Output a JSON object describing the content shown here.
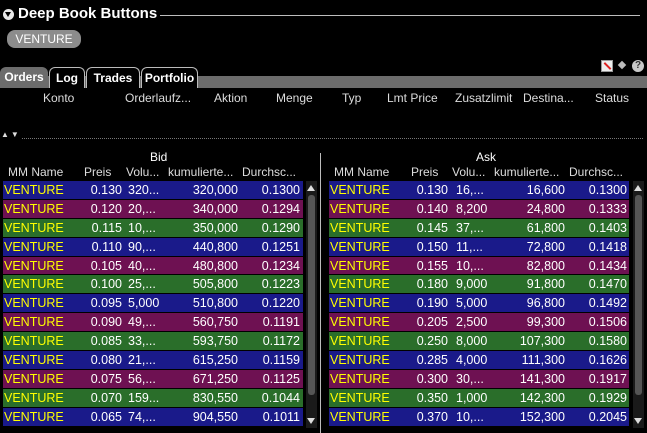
{
  "window": {
    "title": "Deep Book Buttons"
  },
  "symbol_chip": "VENTURE",
  "tabs": [
    "Orders",
    "Log",
    "Trades",
    "Portfolio"
  ],
  "toolbar_icons": [
    "no-edit-icon",
    "wrench-icon",
    "help-icon"
  ],
  "help_glyph": "?",
  "orders_columns": [
    "Konto",
    "Orderlaufz...",
    "Aktion",
    "Menge",
    "Typ",
    "Lmt Price",
    "Zusatzlimit",
    "Destina...",
    "Status"
  ],
  "bid": {
    "title": "Bid",
    "columns": [
      "MM Name",
      "Preis",
      "Volu...",
      "kumulierte...",
      "Durchsc..."
    ],
    "rows": [
      {
        "mm": "VENTURE",
        "price": "0.130",
        "vol": "320...",
        "cum": "320,000",
        "avg": "0.1300",
        "color": "#1a1a8a"
      },
      {
        "mm": "VENTURE",
        "price": "0.120",
        "vol": "20,...",
        "cum": "340,000",
        "avg": "0.1294",
        "color": "#6e1152"
      },
      {
        "mm": "VENTURE",
        "price": "0.115",
        "vol": "10,...",
        "cum": "350,000",
        "avg": "0.1290",
        "color": "#2a6e2a"
      },
      {
        "mm": "VENTURE",
        "price": "0.110",
        "vol": "90,...",
        "cum": "440,800",
        "avg": "0.1251",
        "color": "#1a1a8a"
      },
      {
        "mm": "VENTURE",
        "price": "0.105",
        "vol": "40,...",
        "cum": "480,800",
        "avg": "0.1234",
        "color": "#6e1152"
      },
      {
        "mm": "VENTURE",
        "price": "0.100",
        "vol": "25,...",
        "cum": "505,800",
        "avg": "0.1223",
        "color": "#2a6e2a"
      },
      {
        "mm": "VENTURE",
        "price": "0.095",
        "vol": "5,000",
        "cum": "510,800",
        "avg": "0.1220",
        "color": "#1a1a8a"
      },
      {
        "mm": "VENTURE",
        "price": "0.090",
        "vol": "49,...",
        "cum": "560,750",
        "avg": "0.1191",
        "color": "#6e1152"
      },
      {
        "mm": "VENTURE",
        "price": "0.085",
        "vol": "33,...",
        "cum": "593,750",
        "avg": "0.1172",
        "color": "#2a6e2a"
      },
      {
        "mm": "VENTURE",
        "price": "0.080",
        "vol": "21,...",
        "cum": "615,250",
        "avg": "0.1159",
        "color": "#1a1a8a"
      },
      {
        "mm": "VENTURE",
        "price": "0.075",
        "vol": "56,...",
        "cum": "671,250",
        "avg": "0.1125",
        "color": "#6e1152"
      },
      {
        "mm": "VENTURE",
        "price": "0.070",
        "vol": "159...",
        "cum": "830,550",
        "avg": "0.1044",
        "color": "#2a6e2a"
      },
      {
        "mm": "VENTURE",
        "price": "0.065",
        "vol": "74,...",
        "cum": "904,550",
        "avg": "0.1011",
        "color": "#1a1a8a"
      }
    ]
  },
  "ask": {
    "title": "Ask",
    "columns": [
      "MM Name",
      "Preis",
      "Volu...",
      "kumulierte...",
      "Durchsc..."
    ],
    "rows": [
      {
        "mm": "VENTURE",
        "price": "0.130",
        "vol": "16,...",
        "cum": "16,600",
        "avg": "0.1300",
        "color": "#1a1a8a"
      },
      {
        "mm": "VENTURE",
        "price": "0.140",
        "vol": "8,200",
        "cum": "24,800",
        "avg": "0.1333",
        "color": "#6e1152"
      },
      {
        "mm": "VENTURE",
        "price": "0.145",
        "vol": "37,...",
        "cum": "61,800",
        "avg": "0.1403",
        "color": "#2a6e2a"
      },
      {
        "mm": "VENTURE",
        "price": "0.150",
        "vol": "11,...",
        "cum": "72,800",
        "avg": "0.1418",
        "color": "#1a1a8a"
      },
      {
        "mm": "VENTURE",
        "price": "0.155",
        "vol": "10,...",
        "cum": "82,800",
        "avg": "0.1434",
        "color": "#6e1152"
      },
      {
        "mm": "VENTURE",
        "price": "0.180",
        "vol": "9,000",
        "cum": "91,800",
        "avg": "0.1470",
        "color": "#2a6e2a"
      },
      {
        "mm": "VENTURE",
        "price": "0.190",
        "vol": "5,000",
        "cum": "96,800",
        "avg": "0.1492",
        "color": "#1a1a8a"
      },
      {
        "mm": "VENTURE",
        "price": "0.205",
        "vol": "2,500",
        "cum": "99,300",
        "avg": "0.1506",
        "color": "#6e1152"
      },
      {
        "mm": "VENTURE",
        "price": "0.250",
        "vol": "8,000",
        "cum": "107,300",
        "avg": "0.1580",
        "color": "#2a6e2a"
      },
      {
        "mm": "VENTURE",
        "price": "0.285",
        "vol": "4,000",
        "cum": "111,300",
        "avg": "0.1626",
        "color": "#1a1a8a"
      },
      {
        "mm": "VENTURE",
        "price": "0.300",
        "vol": "30,...",
        "cum": "141,300",
        "avg": "0.1917",
        "color": "#6e1152"
      },
      {
        "mm": "VENTURE",
        "price": "0.350",
        "vol": "1,000",
        "cum": "142,300",
        "avg": "0.1929",
        "color": "#2a6e2a"
      },
      {
        "mm": "VENTURE",
        "price": "0.370",
        "vol": "10,...",
        "cum": "152,300",
        "avg": "0.2045",
        "color": "#1a1a8a"
      }
    ]
  },
  "colors": {
    "accent_text": "#ffff00",
    "row_blue": "#1a1a8a",
    "row_purple": "#6e1152",
    "row_green": "#2a6e2a"
  }
}
